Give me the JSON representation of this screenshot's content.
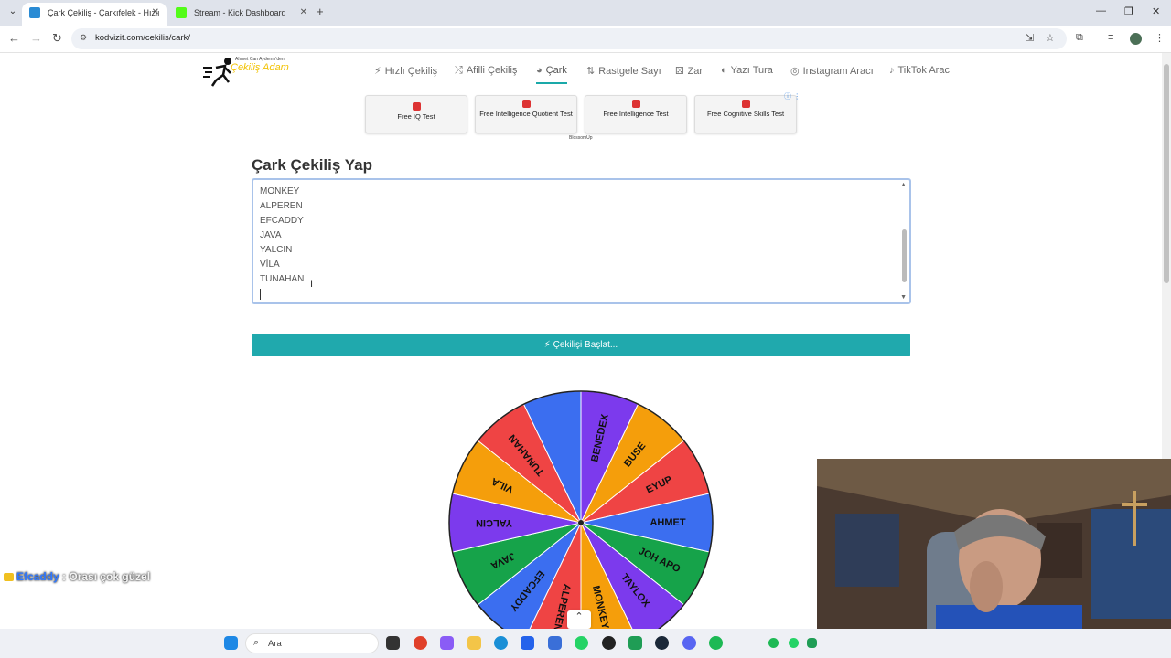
{
  "browser": {
    "tabs": [
      {
        "title": "Çark Çekiliş - Çarkıfelek - Hızlı Ç",
        "active": true
      },
      {
        "title": "Stream - Kick Dashboard",
        "active": false
      }
    ],
    "url": "kodvizit.com/cekilis/cark/"
  },
  "site": {
    "logo_small": "Ahmet Can Aydemir'den",
    "logo_main": "Çekiliş Adam",
    "nav": [
      {
        "label": "Hızlı Çekiliş",
        "icon": "bolt-icon",
        "glyph": "⚡"
      },
      {
        "label": "Afilli Çekiliş",
        "icon": "shuffle-icon",
        "glyph": "⤮"
      },
      {
        "label": "Çark",
        "icon": "pie-icon",
        "glyph": "◕",
        "active": true
      },
      {
        "label": "Rastgele Sayı",
        "icon": "sort-icon",
        "glyph": "⇅"
      },
      {
        "label": "Zar",
        "icon": "dice-icon",
        "glyph": "⚄"
      },
      {
        "label": "Yazı Tura",
        "icon": "coin-icon",
        "glyph": "◐"
      },
      {
        "label": "Instagram Aracı",
        "icon": "instagram-icon",
        "glyph": "◎"
      },
      {
        "label": "TikTok Aracı",
        "icon": "tiktok-icon",
        "glyph": "♪"
      }
    ]
  },
  "ads": {
    "items": [
      "Free IQ Test",
      "Free Intelligence Quotient Test",
      "Free Intelligence Test",
      "Free Cognitive Skills Test"
    ],
    "credit": "BlossomUp"
  },
  "main": {
    "heading": "Çark Çekiliş Yap",
    "entries": [
      "MONKEY",
      "ALPEREN",
      "EFCADDY",
      "JAVA",
      "YALCIN",
      "VİLA",
      "TUNAHAN"
    ],
    "start_button": "Çekilişi Başlat..."
  },
  "wheel": {
    "segments": [
      {
        "label": "BENEDEX",
        "color": "#7c3aed"
      },
      {
        "label": "BUSE",
        "color": "#f59e0b"
      },
      {
        "label": "EYUP",
        "color": "#ef4444"
      },
      {
        "label": "AHMET",
        "color": "#3b6ef0"
      },
      {
        "label": "JOH APO",
        "color": "#16a34a"
      },
      {
        "label": "TAYLOX",
        "color": "#7c3aed"
      },
      {
        "label": "MONKEY",
        "color": "#f59e0b"
      },
      {
        "label": "ALPEREN",
        "color": "#ef4444"
      },
      {
        "label": "EFCADDY",
        "color": "#3b6ef0"
      },
      {
        "label": "JAVA",
        "color": "#16a34a"
      },
      {
        "label": "YALCIN",
        "color": "#7c3aed"
      },
      {
        "label": "VILA",
        "color": "#f59e0b"
      },
      {
        "label": "TUNAHAN",
        "color": "#ef4444"
      },
      {
        "label": "",
        "color": "#3b6ef0"
      }
    ]
  },
  "chat": {
    "user": "Efcaddy",
    "message": ": Orası çok güzel"
  },
  "taskbar": {
    "search_placeholder": "Ara"
  }
}
